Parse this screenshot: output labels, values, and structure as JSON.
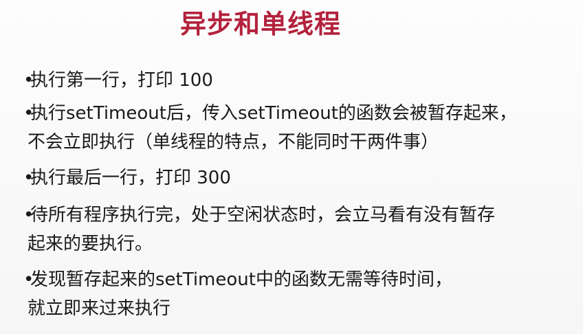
{
  "slide": {
    "title": "异步和单线程",
    "bullet_glyph": "•",
    "bullets": [
      {
        "lines": [
          "执行第一行，打印 100"
        ]
      },
      {
        "lines": [
          "执行setTimeout后，传入setTimeout的函数会被暂存起来，",
          "不会立即执行（单线程的特点，不能同时干两件事）"
        ]
      },
      {
        "lines": [
          "执行最后一行，打印 300"
        ]
      },
      {
        "lines": [
          "待所有程序执行完，处于空闲状态时，会立马看有没有暂存",
          "起来的要执行。"
        ]
      },
      {
        "lines": [
          "发现暂存起来的setTimeout中的函数无需等待时间，",
          "就立即来过来执行"
        ]
      }
    ]
  }
}
